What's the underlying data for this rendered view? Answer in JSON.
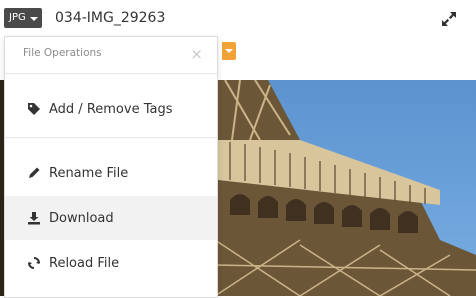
{
  "toolbar": {
    "file_type_label": "JPG",
    "filename": "034-IMG_29263"
  },
  "panel": {
    "title": "File Operations",
    "close_glyph": "×",
    "items": [
      {
        "label": "Add / Remove Tags",
        "icon": "tag-icon"
      },
      {
        "label": "Rename File",
        "icon": "pencil-icon"
      },
      {
        "label": "Download",
        "icon": "download-icon"
      },
      {
        "label": "Reload File",
        "icon": "reload-icon"
      }
    ]
  },
  "colors": {
    "accent": "#f1a33a",
    "toolbar_button": "#4a4a4a",
    "sky": "#6aa3dc"
  }
}
